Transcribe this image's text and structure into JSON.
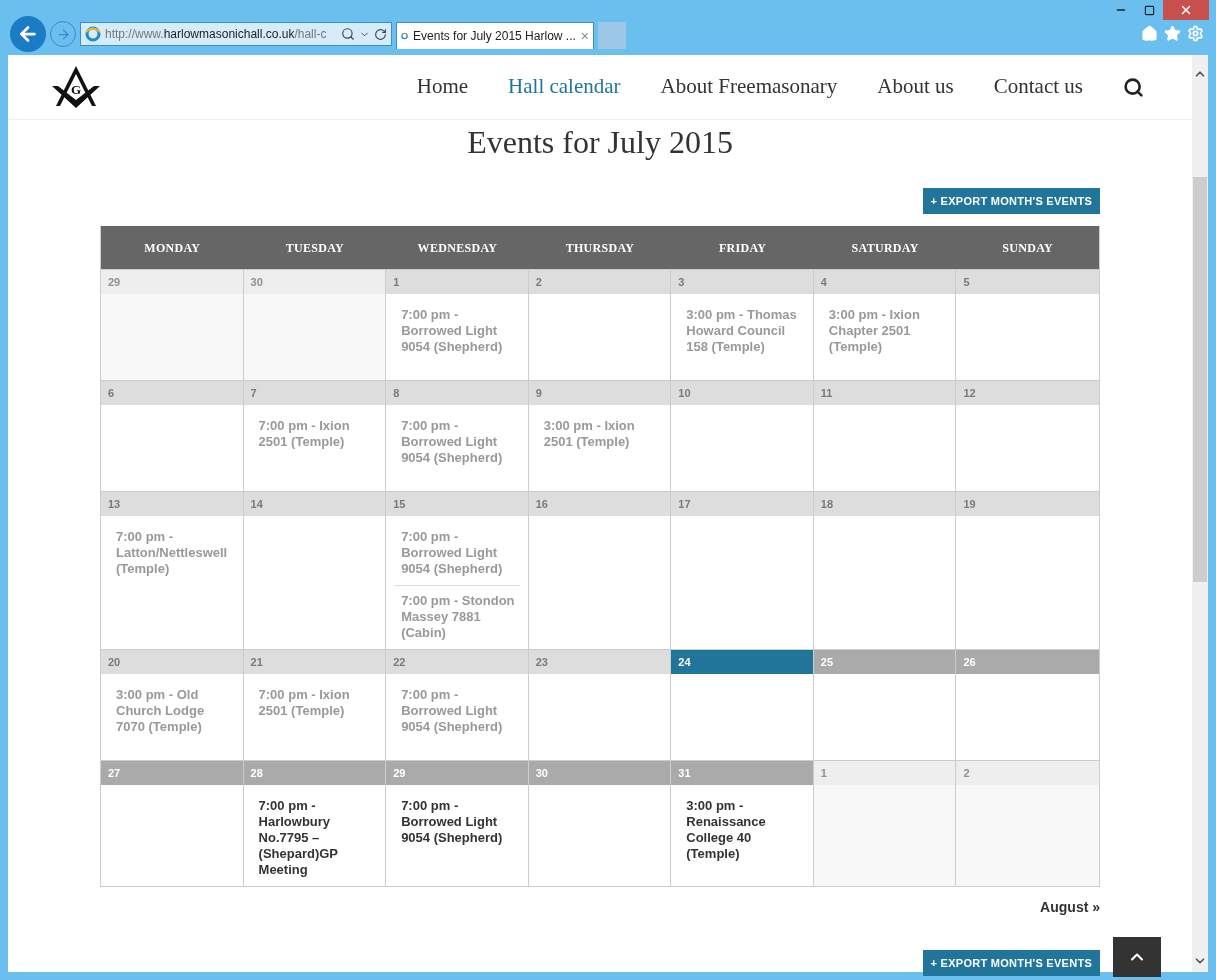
{
  "browser": {
    "address": {
      "prefix": "http://www.",
      "domain": "harlowmasonichall.co.uk",
      "path": "/hall-c"
    },
    "tab_title": "Events for July 2015 Harlow ...",
    "tab_close": "×"
  },
  "nav": [
    {
      "label": "Home",
      "selected": false
    },
    {
      "label": "Hall calendar",
      "selected": true
    },
    {
      "label": "About Freemasonary",
      "selected": false
    },
    {
      "label": "About us",
      "selected": false
    },
    {
      "label": "Contact us",
      "selected": false
    }
  ],
  "logo_letter": "G",
  "title": "Events for July 2015",
  "export_button": "+ EXPORT MONTH'S EVENTS",
  "weekdays": [
    "MONDAY",
    "TUESDAY",
    "WEDNESDAY",
    "THURSDAY",
    "FRIDAY",
    "SATURDAY",
    "SUNDAY"
  ],
  "weeks": [
    {
      "days": [
        {
          "date": "29",
          "kind": "other"
        },
        {
          "date": "30",
          "kind": "other"
        },
        {
          "date": "1",
          "kind": "past",
          "events": [
            "7:00 pm - Borrowed Light 9054 (Shepherd)"
          ]
        },
        {
          "date": "2",
          "kind": "past"
        },
        {
          "date": "3",
          "kind": "past",
          "events": [
            "3:00 pm - Thomas Howard Council 158 (Temple)"
          ]
        },
        {
          "date": "4",
          "kind": "past",
          "events": [
            "3:00 pm - Ixion Chapter 2501 (Temple)"
          ]
        },
        {
          "date": "5",
          "kind": "past"
        }
      ]
    },
    {
      "days": [
        {
          "date": "6",
          "kind": "past"
        },
        {
          "date": "7",
          "kind": "past",
          "events": [
            "7:00 pm - Ixion 2501 (Temple)"
          ]
        },
        {
          "date": "8",
          "kind": "past",
          "events": [
            "7:00 pm - Borrowed Light 9054 (Shepherd)"
          ]
        },
        {
          "date": "9",
          "kind": "past",
          "events": [
            "3:00 pm - Ixion 2501 (Temple)"
          ]
        },
        {
          "date": "10",
          "kind": "past"
        },
        {
          "date": "11",
          "kind": "past"
        },
        {
          "date": "12",
          "kind": "past"
        }
      ]
    },
    {
      "days": [
        {
          "date": "13",
          "kind": "past",
          "events": [
            "7:00 pm - Latton/Nettleswell (Temple)"
          ]
        },
        {
          "date": "14",
          "kind": "past"
        },
        {
          "date": "15",
          "kind": "past",
          "events": [
            "7:00 pm - Borrowed Light 9054 (Shepherd)",
            "7:00 pm - Stondon Massey 7881 (Cabin)"
          ]
        },
        {
          "date": "16",
          "kind": "past"
        },
        {
          "date": "17",
          "kind": "past"
        },
        {
          "date": "18",
          "kind": "past"
        },
        {
          "date": "19",
          "kind": "past"
        }
      ]
    },
    {
      "days": [
        {
          "date": "20",
          "kind": "past",
          "events": [
            "3:00 pm - Old Church Lodge 7070 (Temple)"
          ]
        },
        {
          "date": "21",
          "kind": "past",
          "events": [
            "7:00 pm - Ixion 2501 (Temple)"
          ]
        },
        {
          "date": "22",
          "kind": "past",
          "events": [
            "7:00 pm - Borrowed Light 9054 (Shepherd)"
          ]
        },
        {
          "date": "23",
          "kind": "past"
        },
        {
          "date": "24",
          "kind": "today"
        },
        {
          "date": "25",
          "kind": "future"
        },
        {
          "date": "26",
          "kind": "future"
        }
      ]
    },
    {
      "days": [
        {
          "date": "27",
          "kind": "future"
        },
        {
          "date": "28",
          "kind": "future",
          "events": [
            "7:00 pm - Harlowbury No.7795 – (Shepard)GP Meeting"
          ]
        },
        {
          "date": "29",
          "kind": "future",
          "events": [
            "7:00 pm - Borrowed Light 9054 (Shepherd)"
          ]
        },
        {
          "date": "30",
          "kind": "future"
        },
        {
          "date": "31",
          "kind": "future",
          "events": [
            "3:00 pm - Renaissance College 40 (Temple)"
          ]
        },
        {
          "date": "1",
          "kind": "other"
        },
        {
          "date": "2",
          "kind": "other"
        }
      ]
    }
  ],
  "next_month_link": "August »",
  "bottom_export_button": "+ EXPORT MONTH'S EVENTS"
}
